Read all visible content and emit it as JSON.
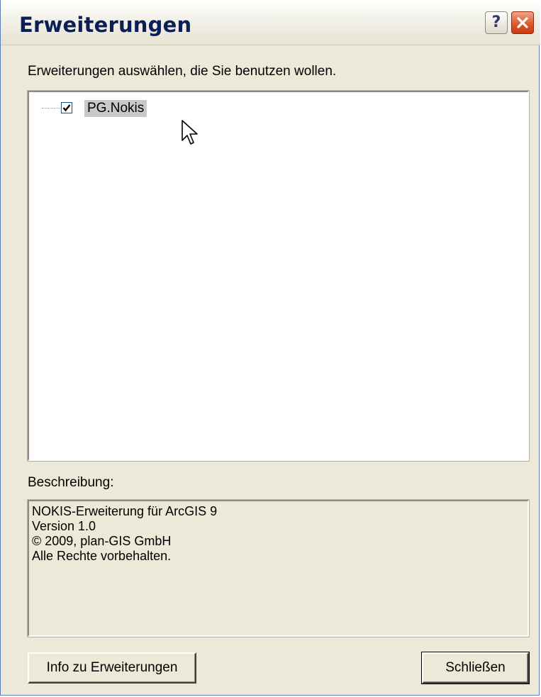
{
  "window": {
    "title": "Erweiterungen",
    "help_icon": "question-mark-icon",
    "close_icon": "close-x-icon"
  },
  "prompt": "Erweiterungen auswählen, die Sie benutzen wollen.",
  "extensions": [
    {
      "label": "PG.Nokis",
      "checked": true,
      "selected": true
    }
  ],
  "description": {
    "label": "Beschreibung:",
    "lines": [
      "NOKIS-Erweiterung für ArcGIS 9",
      "Version 1.0",
      "© 2009, plan-GIS GmbH",
      "Alle Rechte vorbehalten."
    ]
  },
  "buttons": {
    "info": "Info zu Erweiterungen",
    "close": "Schließen"
  },
  "colors": {
    "title_text": "#0b1f56",
    "close_button": "#df5a2c",
    "selection": "#c8c8c8",
    "dialog_bg": "#ece9d8"
  }
}
